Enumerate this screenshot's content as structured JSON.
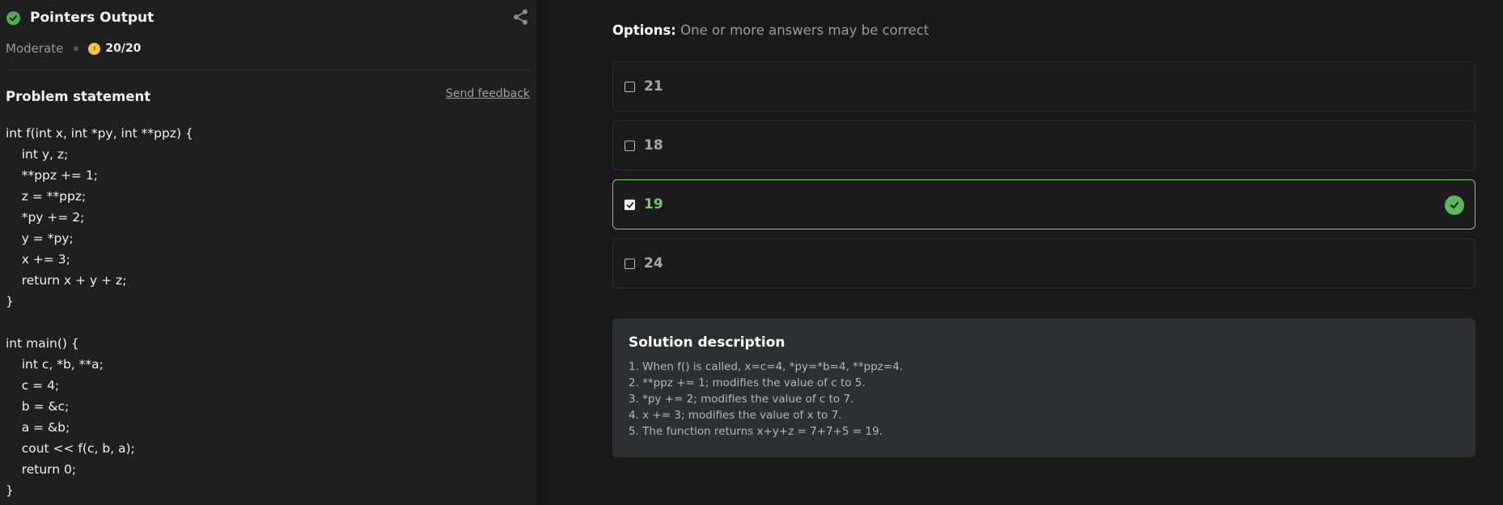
{
  "problem": {
    "title": "Pointers Output",
    "difficulty": "Moderate",
    "score": "20/20",
    "statement_label": "Problem statement",
    "feedback_label": "Send feedback",
    "code_lines": [
      "int f(int x, int *py, int **ppz) {",
      "    int y, z;",
      "    **ppz += 1;",
      "    z = **ppz;",
      "    *py += 2;",
      "    y = *py;",
      "    x += 3;",
      "    return x + y + z;",
      "}",
      "",
      "int main() {",
      "    int c, *b, **a;",
      "    c = 4;",
      "    b = &c;",
      "    a = &b;",
      "    cout << f(c, b, a);",
      "    return 0;",
      "}"
    ]
  },
  "options": {
    "heading": "Options:",
    "subheading": "One or more answers may be correct",
    "items": [
      {
        "label": "21",
        "checked": false,
        "correct": false
      },
      {
        "label": "18",
        "checked": false,
        "correct": false
      },
      {
        "label": "19",
        "checked": true,
        "correct": true
      },
      {
        "label": "24",
        "checked": false,
        "correct": false
      }
    ]
  },
  "solution": {
    "title": "Solution description",
    "lines": [
      "1. When f() is called, x=c=4, *py=*b=4, **ppz=4.",
      "2. **ppz += 1; modifies the value of c to 5.",
      "3. *py += 2; modifies the value of c to 7.",
      "4. x += 3; modifies the value of x to 7.",
      "5. The function returns x+y+z = 7+7+5 = 19."
    ]
  },
  "colors": {
    "accent_green": "#6fcf6f",
    "coin_yellow": "#f5c542"
  },
  "icons": {
    "status": "check-circle-icon",
    "share": "share-icon",
    "coin": "coin-icon",
    "correct": "check-circle-icon"
  }
}
